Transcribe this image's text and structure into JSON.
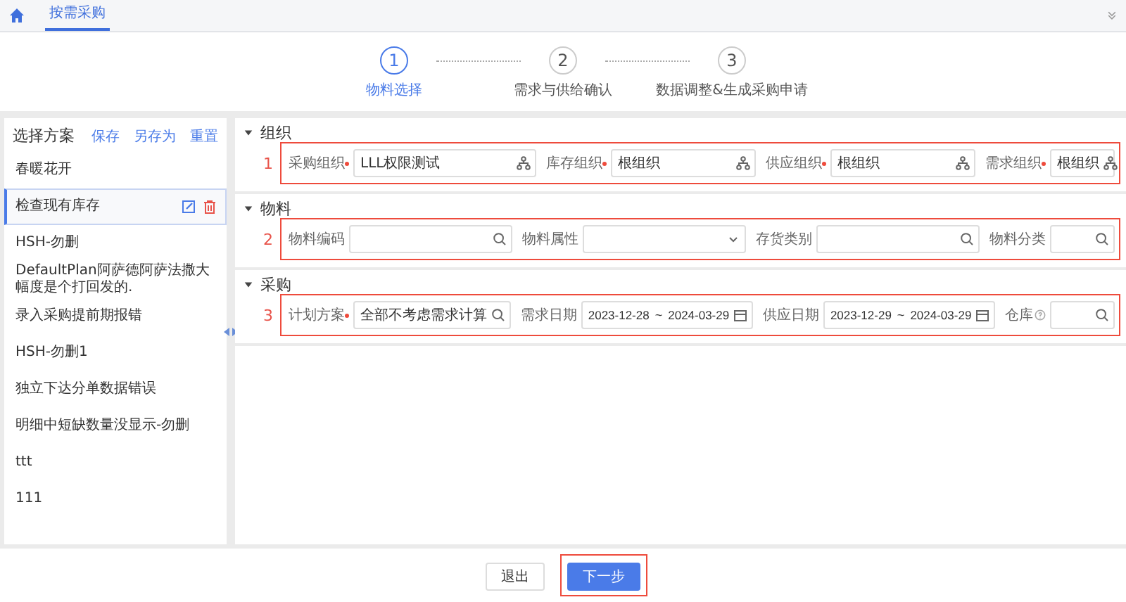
{
  "topbar": {
    "tabs": [
      {
        "label": "按需采购",
        "selected": true
      }
    ]
  },
  "steps": [
    {
      "number": "1",
      "label": "物料选择",
      "selected": true
    },
    {
      "number": "2",
      "label": "需求与供给确认",
      "selected": false
    },
    {
      "number": "3",
      "label": "数据调整&生成采购申请",
      "selected": false
    }
  ],
  "sidebar": {
    "title": "选择方案",
    "actions": [
      "保存",
      "另存为",
      "重置"
    ],
    "items": [
      {
        "label": "春暖花开",
        "selected": false
      },
      {
        "label": "检查现有库存",
        "selected": true
      },
      {
        "label": "HSH-勿删",
        "selected": false
      },
      {
        "label": "DefaultPlan阿萨德阿萨法撒大幅度是个打回发的.",
        "selected": false
      },
      {
        "label": "录入采购提前期报错",
        "selected": false
      },
      {
        "label": "HSH-勿删1",
        "selected": false
      },
      {
        "label": "独立下达分单数据错误",
        "selected": false
      },
      {
        "label": "明细中短缺数量没显示-勿删",
        "selected": false
      },
      {
        "label": "ttt",
        "selected": false
      },
      {
        "label": "111",
        "selected": false
      }
    ]
  },
  "sections": [
    {
      "title": "组织",
      "expanded": true,
      "annotation": "1",
      "fields": [
        {
          "label": "采购组织",
          "required": true,
          "kind": "tree",
          "value": "LLL权限测试"
        },
        {
          "label": "库存组织",
          "required": true,
          "kind": "tree",
          "value": "根组织"
        },
        {
          "label": "供应组织",
          "required": true,
          "kind": "tree",
          "value": "根组织"
        },
        {
          "label": "需求组织",
          "required": true,
          "kind": "tree",
          "value": "根组织"
        }
      ]
    },
    {
      "title": "物料",
      "expanded": true,
      "annotation": "2",
      "fields": [
        {
          "label": "物料编码",
          "required": false,
          "kind": "search"
        },
        {
          "label": "物料属性",
          "required": false,
          "kind": "select"
        },
        {
          "label": "存货类别",
          "required": false,
          "kind": "search"
        },
        {
          "label": "物料分类",
          "required": false,
          "kind": "search"
        }
      ]
    },
    {
      "title": "采购",
      "expanded": true,
      "annotation": "3",
      "fields": [
        {
          "label": "计划方案",
          "required": true,
          "kind": "search",
          "value": "全部不考虑需求计算"
        },
        {
          "label": "需求日期",
          "required": false,
          "kind": "daterange",
          "start": "2023-12-28",
          "separator": "~",
          "end": "2024-03-29"
        },
        {
          "label": "供应日期",
          "required": false,
          "kind": "daterange",
          "start": "2023-12-29",
          "separator": "~",
          "end": "2024-03-29"
        },
        {
          "label": "仓库",
          "required": false,
          "help": true,
          "kind": "search"
        }
      ]
    }
  ],
  "footer": {
    "buttons": [
      {
        "label": "退出",
        "kind": "default",
        "highlighted": false
      },
      {
        "label": "下一步",
        "kind": "primary",
        "highlighted": true
      }
    ]
  }
}
